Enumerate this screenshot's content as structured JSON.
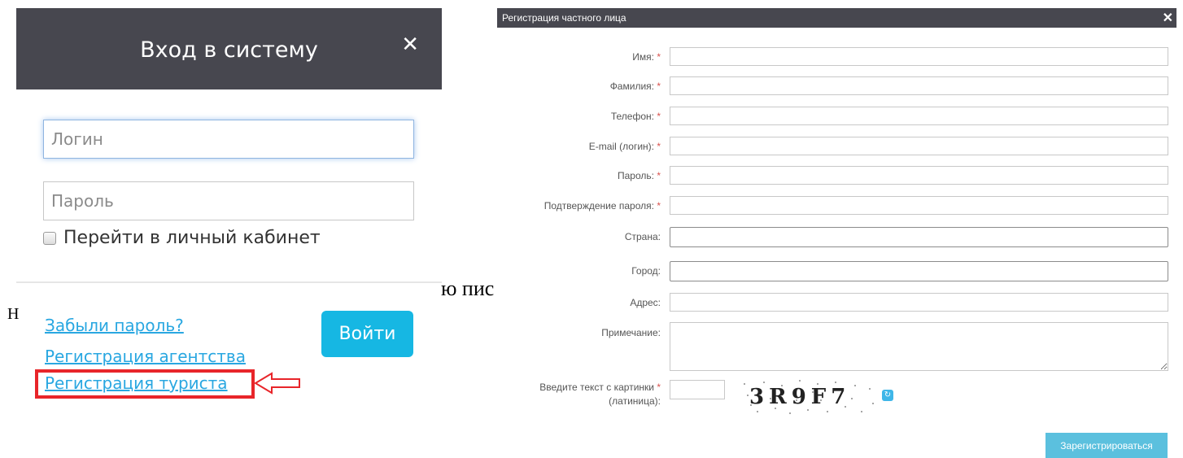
{
  "login": {
    "title": "Вход в систему",
    "close_symbol": "✕",
    "login_placeholder": "Логин",
    "password_placeholder": "Пароль",
    "remember_label": "Перейти в личный кабинет",
    "forgot_link": "Забыли пароль?",
    "agency_link": "Регистрация агентства",
    "tourist_link": "Регистрация туриста",
    "submit_label": "Войти",
    "highlight_color": "#e8252a",
    "accent_color": "#16b7e3",
    "arrow_icon": "arrow-left-outline-icon"
  },
  "background_text": {
    "fragment_1": "ю пис",
    "fragment_2": "Н"
  },
  "registration": {
    "title": "Регистрация частного лица",
    "close_symbol": "✕",
    "fields": [
      {
        "label": "Имя:",
        "required": "*"
      },
      {
        "label": "Фамилия:",
        "required": "*"
      },
      {
        "label": "Телефон:",
        "required": "*"
      },
      {
        "label": "E-mail (логин):",
        "required": "*"
      },
      {
        "label": "Пароль:",
        "required": "*"
      },
      {
        "label": "Подтверждение пароля:",
        "required": "*"
      },
      {
        "label": "Страна:",
        "required": ""
      },
      {
        "label": "Город:",
        "required": ""
      },
      {
        "label": "Адрес:",
        "required": ""
      }
    ],
    "note_label": "Примечание:",
    "captcha_label_line1": "Введите текст с картинки",
    "captcha_required": "*",
    "captcha_label_line2": "(латиница):",
    "captcha_text": "3R9F7",
    "refresh_icon": "refresh-icon",
    "submit_label": "Зарегистрироваться",
    "submit_color": "#5bc0de"
  }
}
